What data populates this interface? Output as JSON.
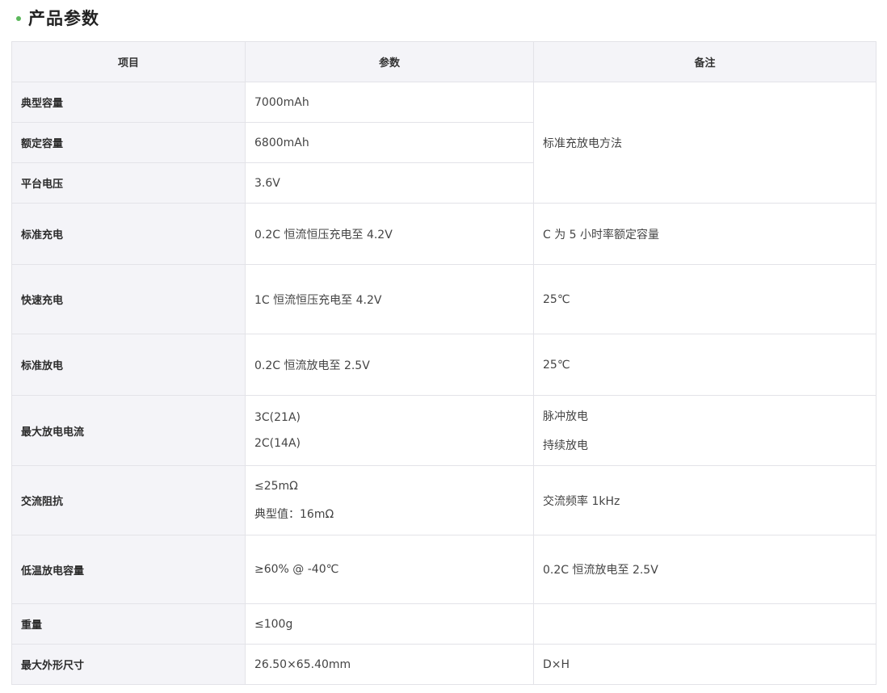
{
  "section": {
    "title": "产品参数"
  },
  "table": {
    "headers": [
      "项目",
      "参数",
      "备注"
    ],
    "rows": [
      {
        "item": "典型容量",
        "param": [
          "7000mAh"
        ],
        "note": [
          "标准充放电方法"
        ]
      },
      {
        "item": "额定容量",
        "param": [
          "6800mAh"
        ]
      },
      {
        "item": "平台电压",
        "param": [
          "3.6V"
        ]
      },
      {
        "item": "标准充电",
        "param": [
          "0.2C 恒流恒压充电至 4.2V"
        ],
        "note": [
          "C 为 5 小时率额定容量"
        ]
      },
      {
        "item": "快速充电",
        "param": [
          "1C 恒流恒压充电至 4.2V"
        ],
        "note": [
          "25℃"
        ]
      },
      {
        "item": "标准放电",
        "param": [
          "0.2C 恒流放电至 2.5V"
        ],
        "note": [
          "25℃"
        ]
      },
      {
        "item": "最大放电电流",
        "param": [
          "3C(21A)",
          "2C(14A)"
        ],
        "note": [
          "脉冲放电",
          "持续放电"
        ]
      },
      {
        "item": "交流阻抗",
        "param": [
          "≤25mΩ",
          "典型值：16mΩ"
        ],
        "note": [
          "交流频率 1kHz"
        ]
      },
      {
        "item": "低温放电容量",
        "param": [
          "≥60% @ -40℃"
        ],
        "note": [
          "0.2C 恒流放电至 2.5V"
        ]
      },
      {
        "item": "重量",
        "param": [
          "≤100g"
        ],
        "note": [
          ""
        ]
      },
      {
        "item": "最大外形尺寸",
        "param": [
          "26.50×65.40mm"
        ],
        "note": [
          "D×H"
        ]
      }
    ]
  }
}
